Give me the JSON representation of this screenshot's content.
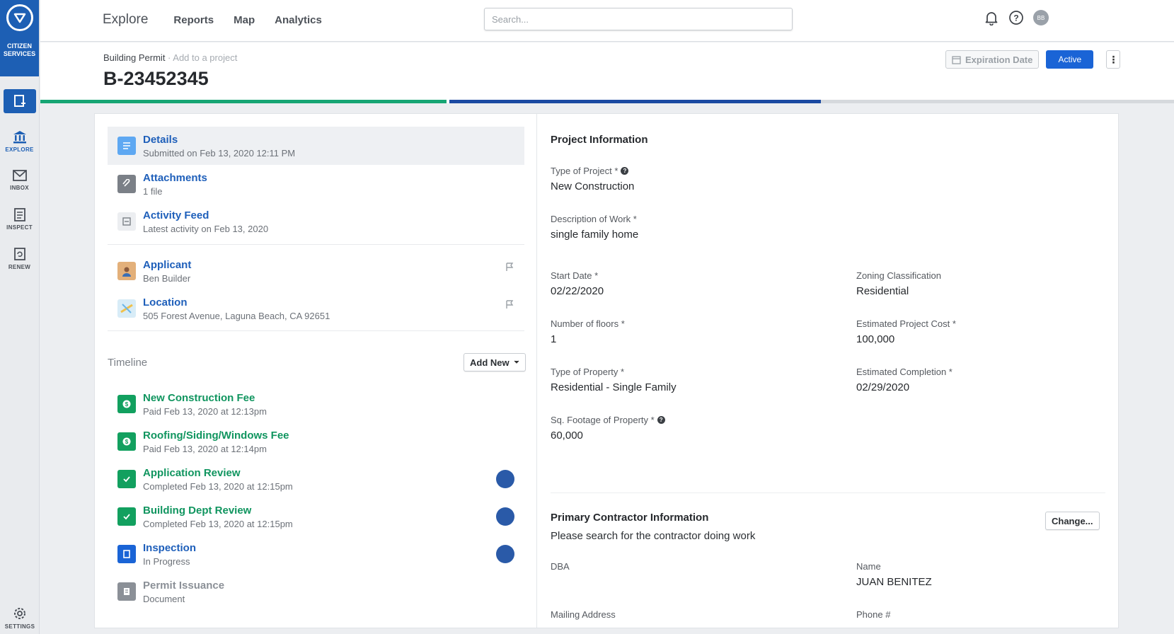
{
  "sidebar": {
    "brand": "CITIZEN SERVICES",
    "items": [
      {
        "label": "EXPLORE"
      },
      {
        "label": "INBOX"
      },
      {
        "label": "INSPECT"
      },
      {
        "label": "RENEW"
      }
    ],
    "settings": "SETTINGS"
  },
  "topbar": {
    "explore": "Explore",
    "links": [
      "Reports",
      "Map",
      "Analytics"
    ],
    "search_placeholder": "Search...",
    "avatar_initials": "BB"
  },
  "record": {
    "breadcrumb": "Building Permit",
    "breadcrumb_add": " · Add to a project",
    "title": "B-23452345",
    "expiration_label": "Expiration Date",
    "status": "Active",
    "more": "⋮",
    "progress": {
      "completed_fraction": 0.38,
      "in_progress_fraction": 0.35
    }
  },
  "left": {
    "items": [
      {
        "title": "Details",
        "subtitle": "Submitted on Feb 13, 2020 12:11 PM"
      },
      {
        "title": "Attachments",
        "subtitle": "1 file"
      },
      {
        "title": "Activity Feed",
        "subtitle": "Latest activity on Feb 13, 2020"
      },
      {
        "title": "Applicant",
        "subtitle": "Ben Builder"
      },
      {
        "title": "Location",
        "subtitle": "505 Forest Avenue, Laguna Beach, CA 92651"
      }
    ],
    "timeline_heading": "Timeline",
    "add_new": "Add New",
    "timeline": [
      {
        "title": "New Construction Fee",
        "subtitle": "Paid Feb 13, 2020 at 12:13pm"
      },
      {
        "title": "Roofing/Siding/Windows Fee",
        "subtitle": "Paid Feb 13, 2020 at 12:14pm"
      },
      {
        "title": "Application Review",
        "subtitle": "Completed Feb 13, 2020 at 12:15pm"
      },
      {
        "title": "Building Dept Review",
        "subtitle": "Completed Feb 13, 2020 at 12:15pm"
      },
      {
        "title": "Inspection",
        "subtitle": "In Progress"
      },
      {
        "title": "Permit Issuance",
        "subtitle": "Document"
      }
    ]
  },
  "project": {
    "heading": "Project Information",
    "type_of_project_label": "Type of Project *",
    "type_of_project": "New Construction",
    "description_label": "Description of Work *",
    "description": "single family home",
    "start_date_label": "Start Date *",
    "start_date": "02/22/2020",
    "zoning_label": "Zoning Classification",
    "zoning": "Residential",
    "floors_label": "Number of floors *",
    "floors": "1",
    "cost_label": "Estimated Project Cost *",
    "cost": "100,000",
    "property_type_label": "Type of Property *",
    "property_type": "Residential - Single Family",
    "completion_label": "Estimated Completion *",
    "completion": "02/29/2020",
    "sqft_label": "Sq. Footage of Property *",
    "sqft": "60,000"
  },
  "contractor": {
    "heading": "Primary Contractor Information",
    "change": "Change...",
    "hint": "Please search for the contractor doing work",
    "dba_label": "DBA",
    "name_label": "Name",
    "name": "JUAN BENITEZ",
    "mailing_label": "Mailing Address",
    "phone_label": "Phone #"
  },
  "colors": {
    "brand": "#1d5fb4",
    "link": "#1e5fba",
    "success": "#12a05f",
    "active": "#1a64d6"
  }
}
